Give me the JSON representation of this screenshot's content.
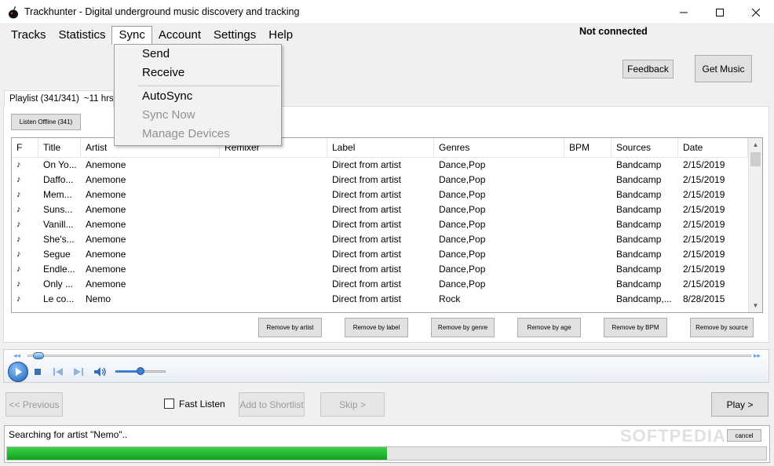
{
  "window": {
    "title": "Trackhunter - Digital underground music discovery and tracking"
  },
  "menu": [
    {
      "label": "Tracks"
    },
    {
      "label": "Statistics"
    },
    {
      "label": "Sync"
    },
    {
      "label": "Account"
    },
    {
      "label": "Settings"
    },
    {
      "label": "Help"
    }
  ],
  "connection_status": "Not connected",
  "header_buttons": {
    "feedback": "Feedback",
    "get_music": "Get Music"
  },
  "sync_menu": {
    "send": "Send",
    "receive": "Receive",
    "autosync": "AutoSync",
    "sync_now": "Sync Now",
    "manage_devices": "Manage Devices"
  },
  "playlist": {
    "tab_label": "Playlist (341/341)",
    "duration": "~11 hrs 2",
    "listen_offline": "Listen Offline (341)"
  },
  "table": {
    "columns": [
      "F",
      "Title",
      "Artist",
      "Remixer",
      "Label",
      "Genres",
      "BPM",
      "Sources",
      "Date"
    ],
    "rows": [
      [
        "On Yo...",
        "Anemone",
        "",
        "Direct from artist",
        "Dance,Pop",
        "",
        "Bandcamp",
        "2/15/2019"
      ],
      [
        "Daffo...",
        "Anemone",
        "",
        "Direct from artist",
        "Dance,Pop",
        "",
        "Bandcamp",
        "2/15/2019"
      ],
      [
        "Mem...",
        "Anemone",
        "",
        "Direct from artist",
        "Dance,Pop",
        "",
        "Bandcamp",
        "2/15/2019"
      ],
      [
        "Suns...",
        "Anemone",
        "",
        "Direct from artist",
        "Dance,Pop",
        "",
        "Bandcamp",
        "2/15/2019"
      ],
      [
        "Vanill...",
        "Anemone",
        "",
        "Direct from artist",
        "Dance,Pop",
        "",
        "Bandcamp",
        "2/15/2019"
      ],
      [
        "She's...",
        "Anemone",
        "",
        "Direct from artist",
        "Dance,Pop",
        "",
        "Bandcamp",
        "2/15/2019"
      ],
      [
        "Segue",
        "Anemone",
        "",
        "Direct from artist",
        "Dance,Pop",
        "",
        "Bandcamp",
        "2/15/2019"
      ],
      [
        "Endle...",
        "Anemone",
        "",
        "Direct from artist",
        "Dance,Pop",
        "",
        "Bandcamp",
        "2/15/2019"
      ],
      [
        "Only ...",
        "Anemone",
        "",
        "Direct from artist",
        "Dance,Pop",
        "",
        "Bandcamp",
        "2/15/2019"
      ],
      [
        "Le co...",
        "Nemo",
        "",
        "Direct from artist",
        "Rock",
        "",
        "Bandcamp,...",
        "8/28/2015"
      ]
    ]
  },
  "remove_buttons": {
    "artist": "Remove by artist",
    "label": "Remove by label",
    "genre": "Remove by genre",
    "age": "Remove by age",
    "bpm": "Remove by BPM",
    "source": "Remove by source"
  },
  "player": {
    "seek_fraction": 0.01,
    "volume_fraction": 0.5
  },
  "nav": {
    "previous": "<< Previous",
    "fast_listen": "Fast Listen",
    "add_to_shortlist": "Add to Shortlist",
    "skip": "Skip >",
    "play": "Play >"
  },
  "status": {
    "text": "Searching for artist \"Nemo\"..",
    "cancel": "cancel",
    "progress_fraction": 0.5
  },
  "watermark": "SOFTPEDIA"
}
